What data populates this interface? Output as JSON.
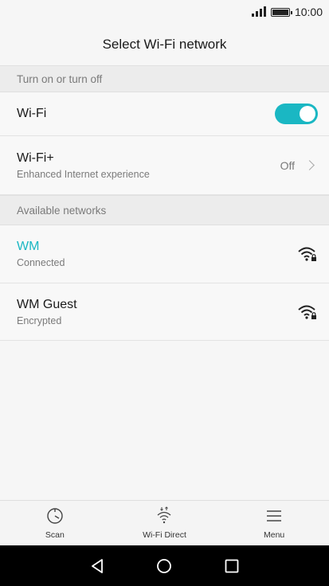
{
  "status": {
    "time": "10:00"
  },
  "header": {
    "title": "Select Wi-Fi network"
  },
  "section_toggle": {
    "label": "Turn on or turn off"
  },
  "wifi": {
    "label": "Wi-Fi",
    "on": true
  },
  "wifi_plus": {
    "label": "Wi-Fi+",
    "sublabel": "Enhanced Internet experience",
    "value": "Off"
  },
  "section_available": {
    "label": "Available networks"
  },
  "networks": [
    {
      "name": "WM",
      "status": "Connected",
      "active": true
    },
    {
      "name": "WM Guest",
      "status": "Encrypted",
      "active": false
    }
  ],
  "bottom_tabs": [
    {
      "label": "Scan",
      "icon": "scan-icon"
    },
    {
      "label": "Wi-Fi Direct",
      "icon": "wifi-direct-icon"
    },
    {
      "label": "Menu",
      "icon": "menu-icon"
    }
  ],
  "nav": [
    "back-icon",
    "home-icon",
    "recents-icon"
  ],
  "colors": {
    "accent": "#1ab7c3"
  }
}
